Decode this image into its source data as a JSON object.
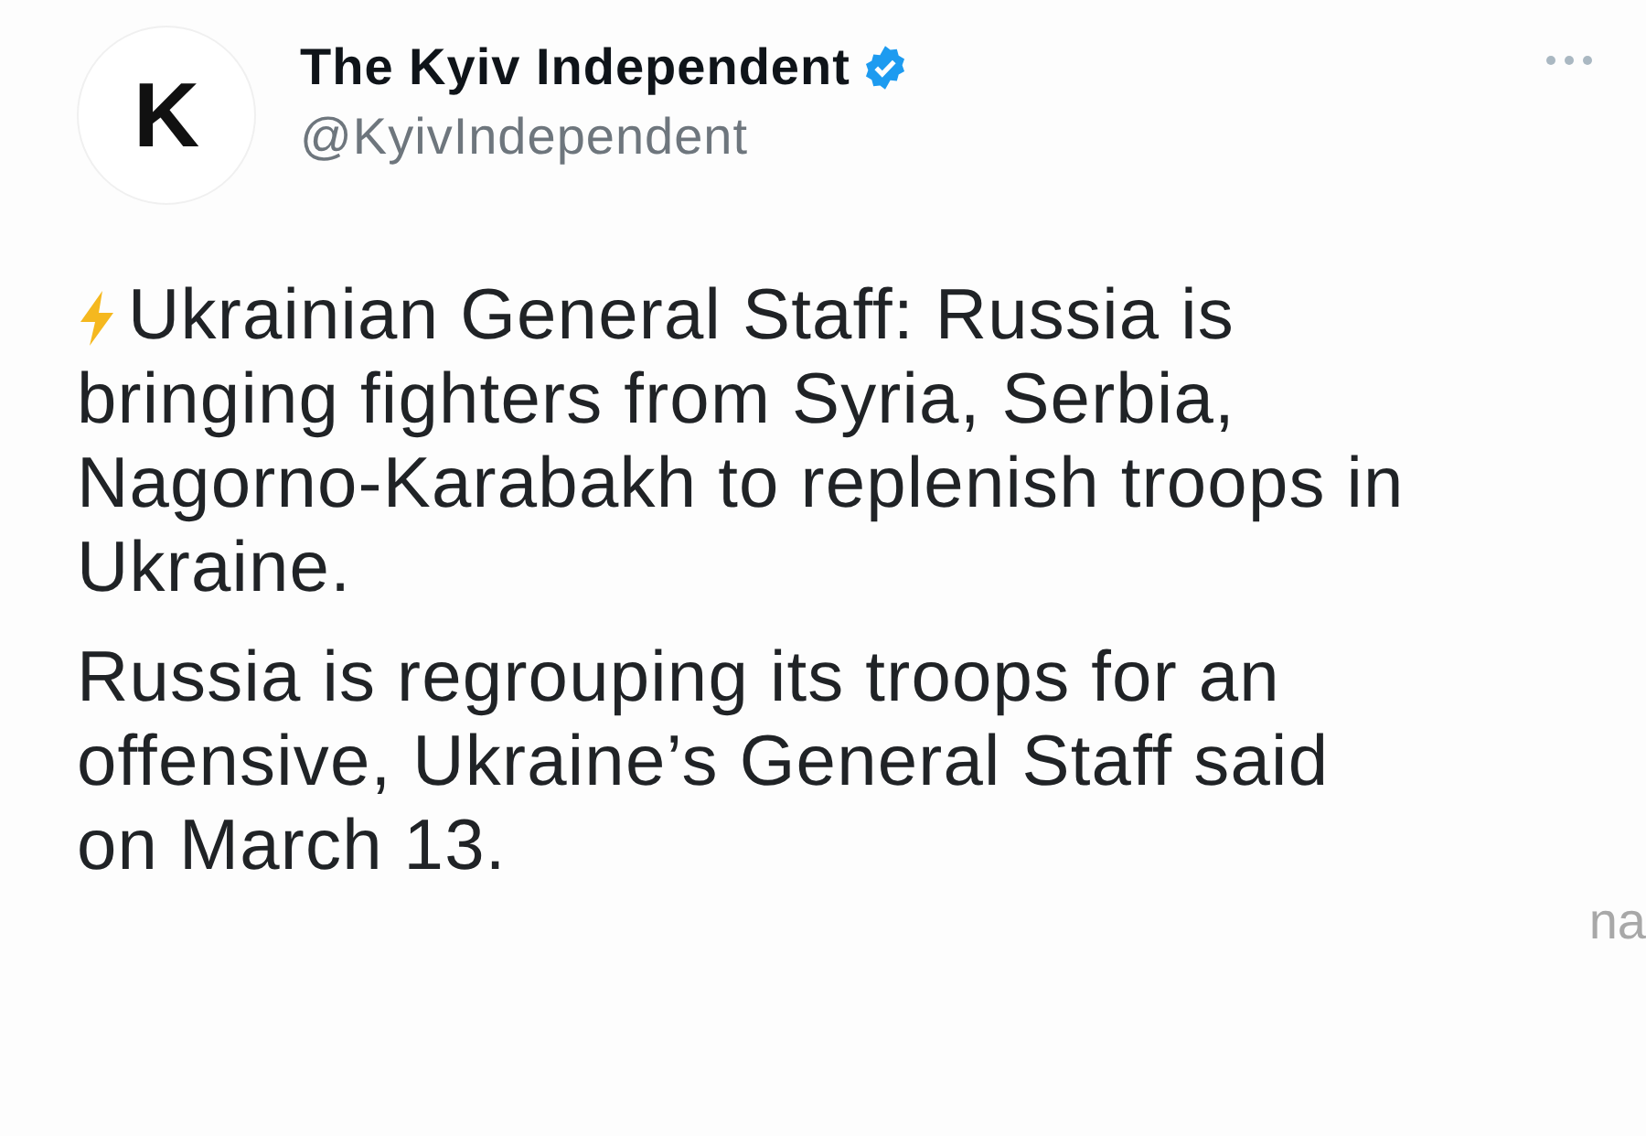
{
  "tweet": {
    "avatar_letter": "K",
    "author_name": "The Kyiv Independent",
    "verified": true,
    "handle": "@KyivIndependent",
    "paragraphs": [
      {
        "kind": "flash",
        "text": "Ukrainian General Staff: Russia is bringing fighters from Syria, Serbia, Nagorno-Karabakh to replenish troops in Ukraine."
      },
      {
        "kind": "plain",
        "text": "Russia is regrouping its troops for an offensive, Ukraine’s General Staff said on March 13."
      }
    ]
  },
  "side_fragment": "na"
}
